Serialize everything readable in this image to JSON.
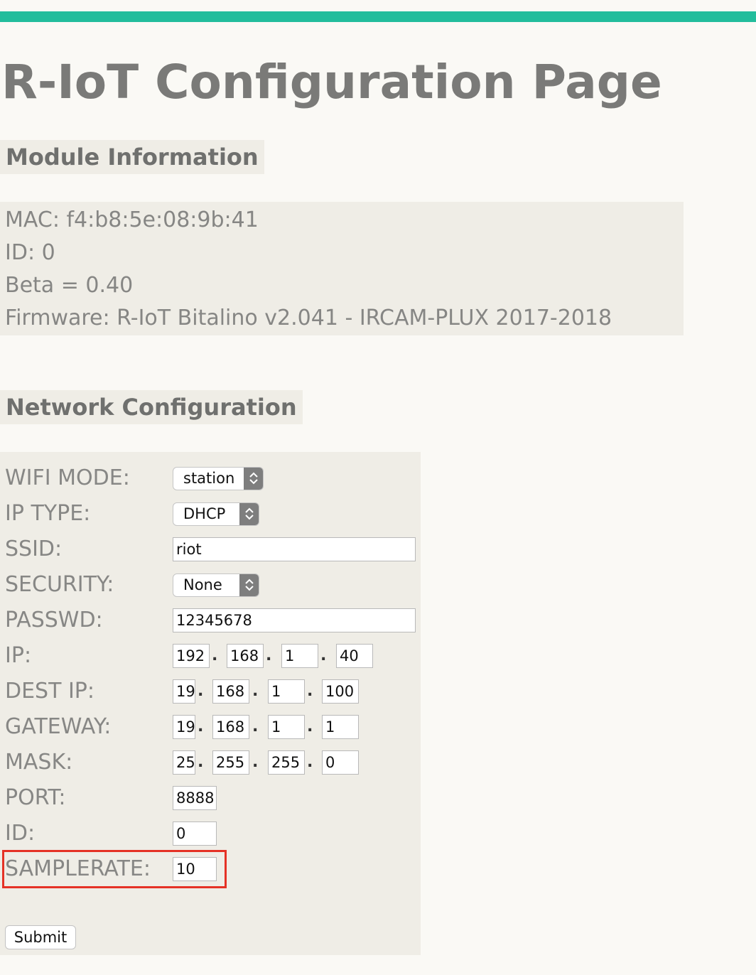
{
  "colors": {
    "accent": "#22bd9c",
    "highlight": "#e53226",
    "panel": "#efede6",
    "background": "#faf9f5"
  },
  "page_title": "R-IoT Configuration Page",
  "module_info": {
    "heading": "Module Information",
    "mac": "MAC: f4:b8:5e:08:9b:41",
    "id": "ID: 0",
    "beta": "Beta = 0.40",
    "firmware": "Firmware: R-IoT Bitalino v2.041 - IRCAM-PLUX 2017-2018"
  },
  "network": {
    "heading": "Network Configuration",
    "wifi_mode": {
      "label": "WIFI MODE:",
      "value": "station"
    },
    "ip_type": {
      "label": "IP TYPE:",
      "value": "DHCP"
    },
    "ssid": {
      "label": "SSID:",
      "value": "riot"
    },
    "security": {
      "label": "SECURITY:",
      "value": "None"
    },
    "passwd": {
      "label": "PASSWD:",
      "value": "12345678"
    },
    "ip": {
      "label": "IP:",
      "octets": [
        "192",
        "168",
        "1",
        "40"
      ]
    },
    "dest_ip": {
      "label": "DEST IP:",
      "octets": [
        "19",
        "168",
        "1",
        "100"
      ]
    },
    "gateway": {
      "label": "GATEWAY:",
      "octets": [
        "19",
        "168",
        "1",
        "1"
      ]
    },
    "mask": {
      "label": "MASK:",
      "octets": [
        "25",
        "255",
        "255",
        "0"
      ]
    },
    "port": {
      "label": "PORT:",
      "value": "8888"
    },
    "id": {
      "label": "ID:",
      "value": "0"
    },
    "samplerate": {
      "label": "SAMPLERATE:",
      "value": "10"
    },
    "ip_separator": ".",
    "submit_label": "Submit"
  }
}
